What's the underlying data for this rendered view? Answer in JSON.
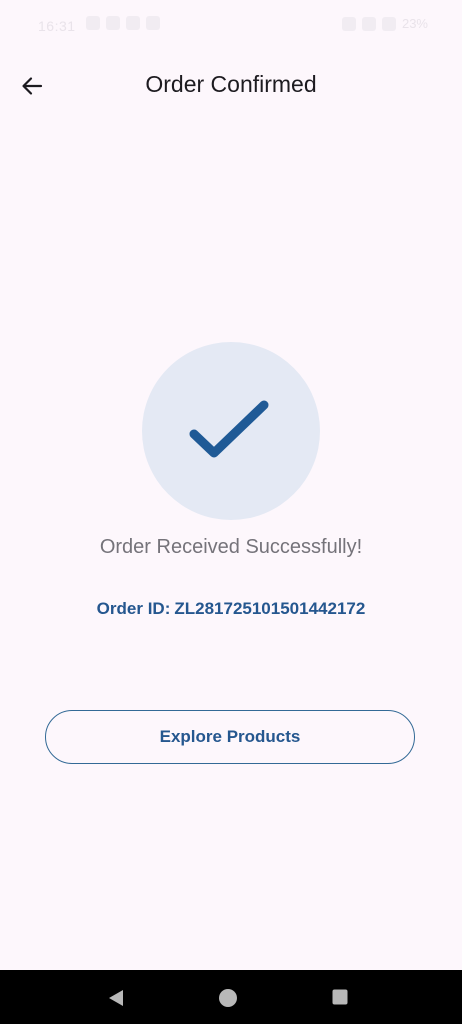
{
  "status_bar": {
    "time": "16:31",
    "battery": "23%"
  },
  "app_bar": {
    "title": "Order Confirmed"
  },
  "confirmation": {
    "message": "Order Received Successfully!",
    "order_id_label": "Order ID:",
    "order_id_value": "ZL281725101501442172"
  },
  "actions": {
    "explore_label": "Explore Products"
  },
  "colors": {
    "accent": "#25578f",
    "check": "#1f5a96",
    "circle_bg": "#e4e9f4",
    "background": "#fdf7fc"
  },
  "icons": {
    "back": "arrow-left-icon",
    "success": "checkmark-icon",
    "nav_back": "triangle-back-icon",
    "nav_home": "circle-home-icon",
    "nav_recent": "square-recent-icon"
  }
}
